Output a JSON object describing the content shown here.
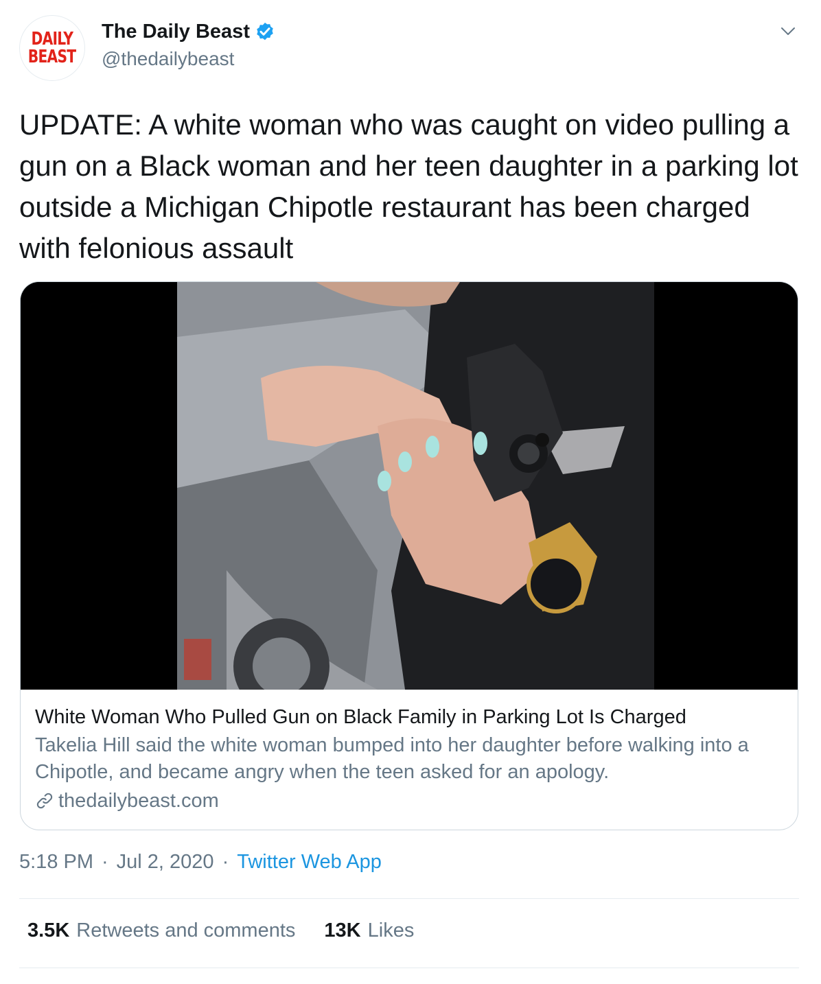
{
  "author": {
    "avatar_line1": "DAILY",
    "avatar_line2": "BEAST",
    "display_name": "The Daily Beast",
    "handle": "@thedailybeast",
    "verified_icon": "verified-badge-icon"
  },
  "tweet": {
    "text": "UPDATE: A white woman who was caught on video pulling a gun on a Black woman and her teen daughter in a parking lot outside a Michigan Chipotle restaurant has been charged with felonious assault"
  },
  "card": {
    "title": "White Woman Who Pulled Gun on Black Family in Parking Lot Is Charged",
    "description": "Takelia Hill said the white woman bumped into her daughter before walking into a Chipotle, and became angry when the teen asked for an apology.",
    "domain": "thedailybeast.com"
  },
  "meta": {
    "time": "5:18 PM",
    "separator": "·",
    "date": "Jul 2, 2020",
    "source": "Twitter Web App"
  },
  "stats": {
    "retweets_count": "3.5K",
    "retweets_label": "Retweets and comments",
    "likes_count": "13K",
    "likes_label": "Likes"
  },
  "colors": {
    "accent": "#1b95e0",
    "verified": "#1da1f2",
    "logo_red": "#e2231a",
    "secondary_text": "#657786"
  }
}
